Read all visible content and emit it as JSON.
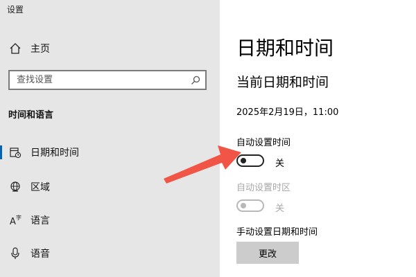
{
  "window": {
    "title": "设置"
  },
  "sidebar": {
    "home_label": "主页",
    "search_placeholder": "查找设置",
    "section_title": "时间和语言",
    "items": [
      {
        "label": "日期和时间",
        "icon": "calendar-clock-icon",
        "active": true
      },
      {
        "label": "区域",
        "icon": "globe-icon"
      },
      {
        "label": "语言",
        "icon": "language-icon"
      },
      {
        "label": "语音",
        "icon": "microphone-icon"
      }
    ]
  },
  "main": {
    "page_title": "日期和时间",
    "subtitle": "当前日期和时间",
    "current_datetime": "2025年2月19日，11:00",
    "auto_time": {
      "label": "自动设置时间",
      "state": "关",
      "on": false
    },
    "auto_timezone": {
      "label": "自动设置时区",
      "state": "关",
      "on": false,
      "disabled": true
    },
    "manual": {
      "label": "手动设置日期和时间",
      "button_label": "更改"
    }
  },
  "colors": {
    "sidebar_bg": "#e6e6e6",
    "accent": "#0063b1",
    "annotation_arrow": "#f05545"
  }
}
